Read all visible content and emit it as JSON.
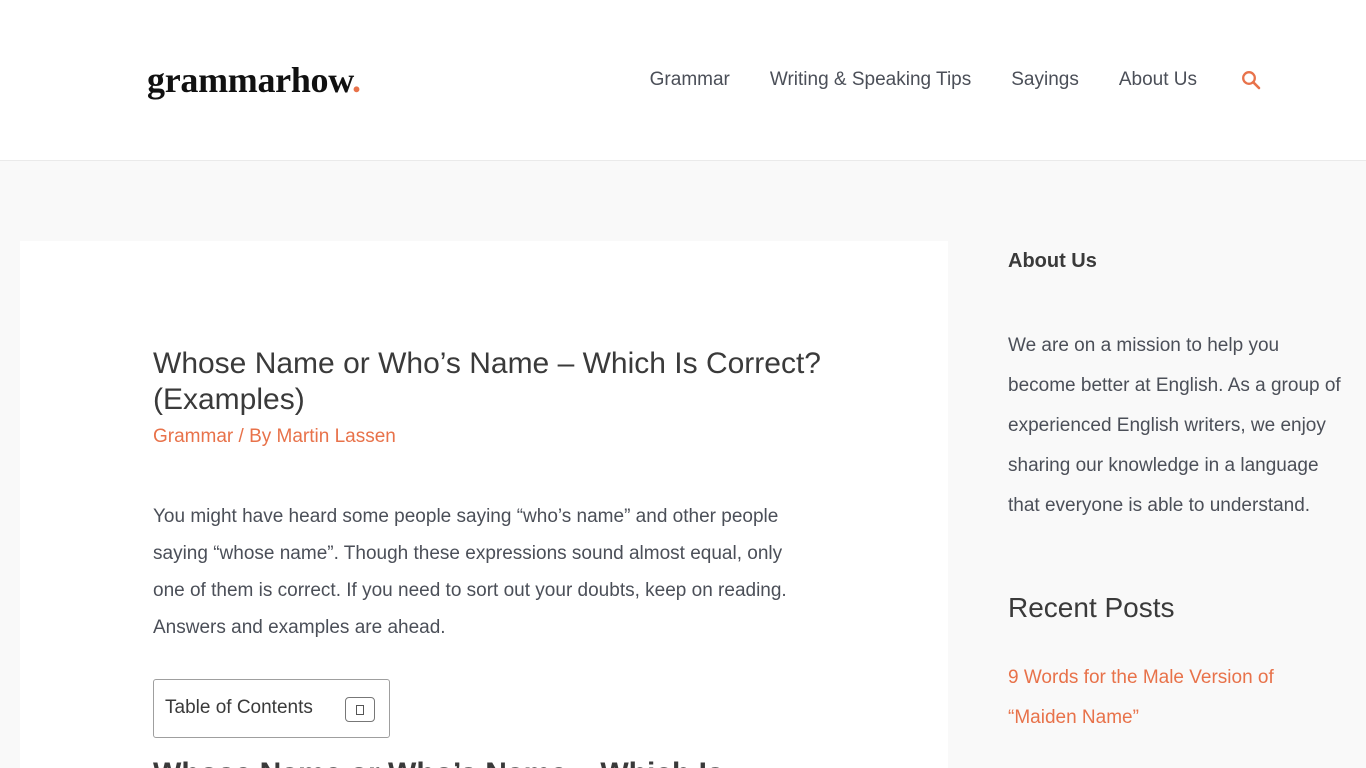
{
  "header": {
    "logo_text": "grammarhow",
    "logo_dot": ".",
    "nav": [
      {
        "label": "Grammar"
      },
      {
        "label": "Writing & Speaking Tips"
      },
      {
        "label": "Sayings"
      },
      {
        "label": "About Us"
      }
    ],
    "search_icon": "search-icon"
  },
  "article": {
    "title": "Whose Name or Who’s Name – Which Is Correct? (Examples)",
    "meta": {
      "category": "Grammar",
      "separator": " / By ",
      "author": "Martin Lassen"
    },
    "excerpt": "You might have heard some people saying “who’s name” and other people saying “whose name”. Though these expressions sound almost equal, only one of them is correct. If you need to sort out your doubts, keep on reading. Answers and examples are ahead.",
    "toc": {
      "title": "Table of Contents"
    },
    "next_heading": "Whose Name or Who’s Name – Which Is"
  },
  "sidebar": {
    "about_title": "About Us",
    "about_text": "We are on a mission to help you become better at English. As a group of experienced English writers, we enjoy sharing our knowledge in a language that everyone is able to understand.",
    "recent_title": "Recent Posts",
    "recent_posts": [
      {
        "label": "9 Words for the Male Version of “Maiden Name”"
      }
    ]
  },
  "colors": {
    "accent": "#e8724a",
    "text": "#3a3a3a",
    "background": "#f9f9f9"
  }
}
